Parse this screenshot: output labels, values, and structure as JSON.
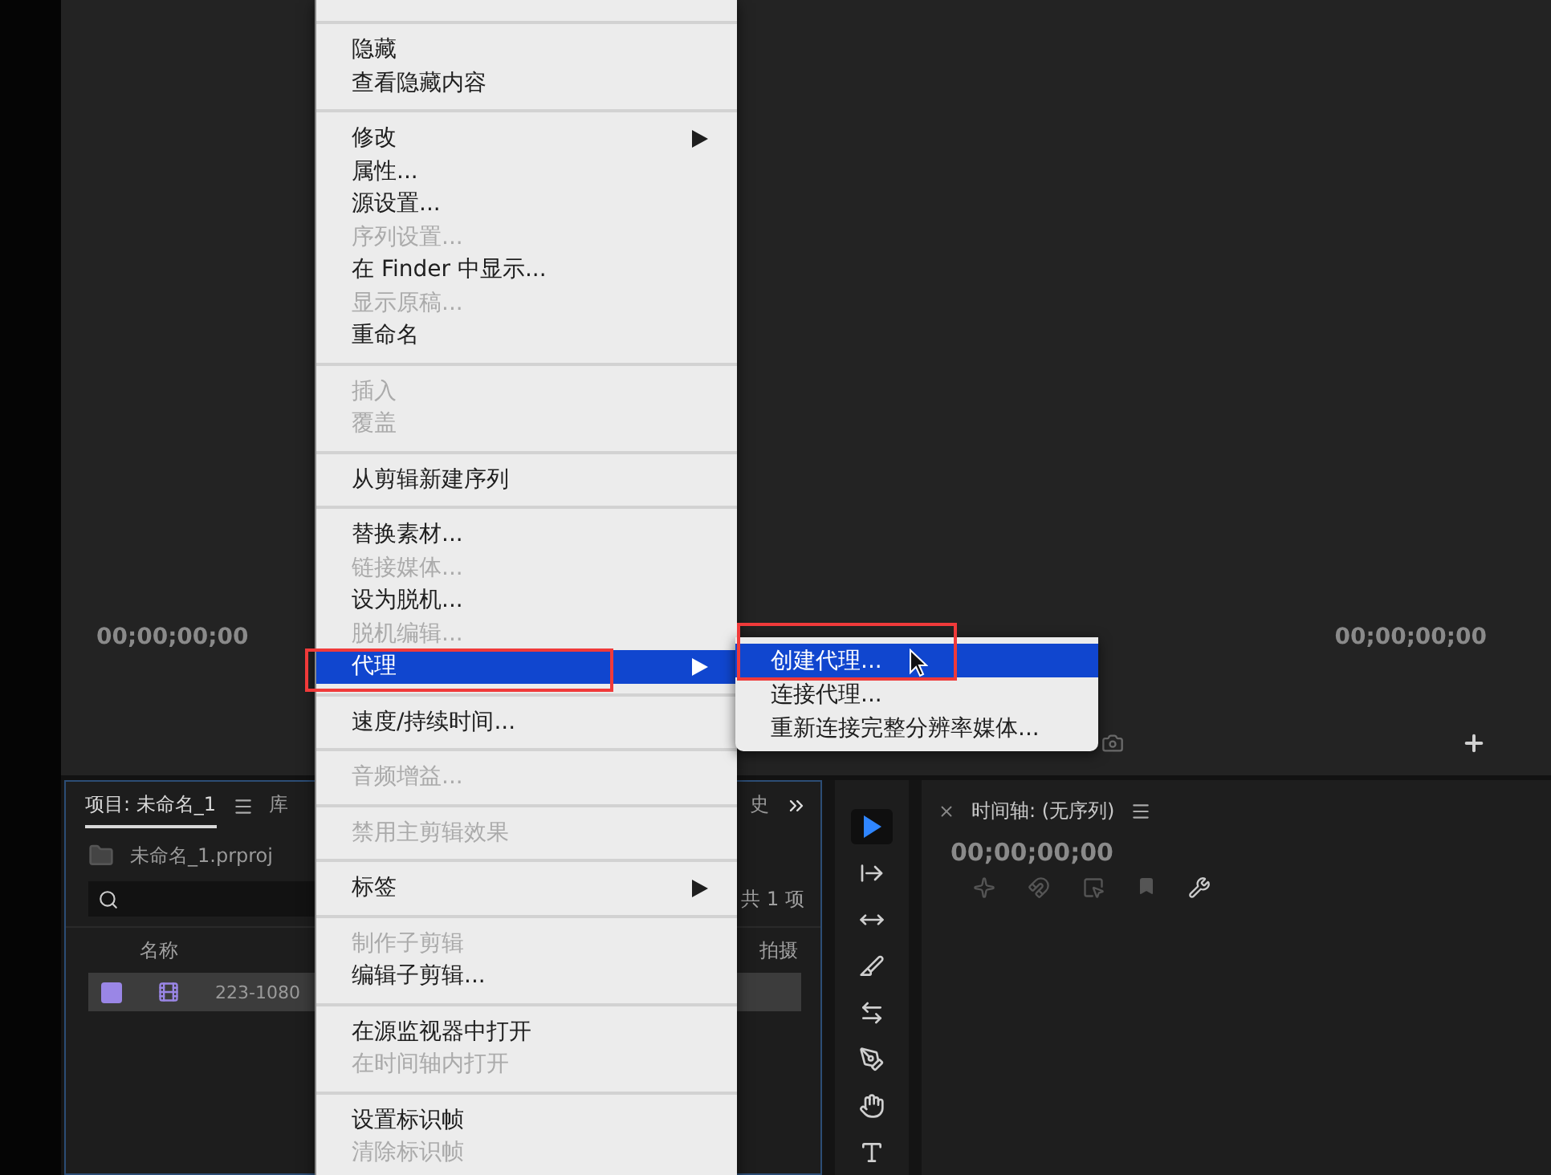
{
  "source_monitor": {
    "timecode_left": "00;00;00;00",
    "timecode_right": "00;00;00;00"
  },
  "project_panel": {
    "tabs": [
      {
        "label": "项目: 未命名_1",
        "selected": true
      },
      {
        "label": "库",
        "selected": false
      },
      {
        "label": "史",
        "selected": false
      }
    ],
    "file": "未命名_1.prproj",
    "item_count": "共 1 项",
    "columns": [
      "名称",
      "拍摄"
    ],
    "rows": [
      {
        "name": "223-1080",
        "selected": true,
        "color": "#9a86e6"
      }
    ]
  },
  "tools": [
    {
      "kind": "selection",
      "selected": true
    },
    {
      "kind": "track",
      "selected": false
    },
    {
      "kind": "ripple",
      "selected": false
    },
    {
      "kind": "razor",
      "selected": false
    },
    {
      "kind": "slip",
      "selected": false
    },
    {
      "kind": "pen",
      "selected": false
    },
    {
      "kind": "hand",
      "selected": false
    },
    {
      "kind": "type",
      "selected": false
    }
  ],
  "timeline_panel": {
    "title": "时间轴: (无序列)",
    "timecode": "00;00;00;00"
  },
  "context_menu": {
    "groups": [
      {
        "items": [
          {
            "label": "隐藏",
            "disabled": false,
            "submenu": false,
            "selected": false
          },
          {
            "label": "查看隐藏内容",
            "disabled": false,
            "submenu": false,
            "selected": false
          }
        ]
      },
      {
        "items": [
          {
            "label": "修改",
            "disabled": false,
            "submenu": true,
            "selected": false
          },
          {
            "label": "属性...",
            "disabled": false,
            "submenu": false,
            "selected": false
          },
          {
            "label": "源设置...",
            "disabled": false,
            "submenu": false,
            "selected": false
          },
          {
            "label": "序列设置...",
            "disabled": true,
            "submenu": false,
            "selected": false
          },
          {
            "label": "在 Finder 中显示...",
            "disabled": false,
            "submenu": false,
            "selected": false
          },
          {
            "label": "显示原稿...",
            "disabled": true,
            "submenu": false,
            "selected": false
          },
          {
            "label": "重命名",
            "disabled": false,
            "submenu": false,
            "selected": false
          }
        ]
      },
      {
        "items": [
          {
            "label": "插入",
            "disabled": true,
            "submenu": false,
            "selected": false
          },
          {
            "label": "覆盖",
            "disabled": true,
            "submenu": false,
            "selected": false
          }
        ]
      },
      {
        "items": [
          {
            "label": "从剪辑新建序列",
            "disabled": false,
            "submenu": false,
            "selected": false
          }
        ]
      },
      {
        "items": [
          {
            "label": "替换素材...",
            "disabled": false,
            "submenu": false,
            "selected": false
          },
          {
            "label": "链接媒体...",
            "disabled": true,
            "submenu": false,
            "selected": false
          },
          {
            "label": "设为脱机...",
            "disabled": false,
            "submenu": false,
            "selected": false
          },
          {
            "label": "脱机编辑...",
            "disabled": true,
            "submenu": false,
            "selected": false
          },
          {
            "label": "代理",
            "disabled": false,
            "submenu": true,
            "selected": true
          }
        ]
      },
      {
        "items": [
          {
            "label": "速度/持续时间...",
            "disabled": false,
            "submenu": false,
            "selected": false
          }
        ]
      },
      {
        "items": [
          {
            "label": "音频增益...",
            "disabled": true,
            "submenu": false,
            "selected": false
          }
        ]
      },
      {
        "items": [
          {
            "label": "禁用主剪辑效果",
            "disabled": true,
            "submenu": false,
            "selected": false
          }
        ]
      },
      {
        "items": [
          {
            "label": "标签",
            "disabled": false,
            "submenu": true,
            "selected": false
          }
        ]
      },
      {
        "items": [
          {
            "label": "制作子剪辑",
            "disabled": true,
            "submenu": false,
            "selected": false
          },
          {
            "label": "编辑子剪辑...",
            "disabled": false,
            "submenu": false,
            "selected": false
          }
        ]
      },
      {
        "items": [
          {
            "label": "在源监视器中打开",
            "disabled": false,
            "submenu": false,
            "selected": false
          },
          {
            "label": "在时间轴内打开",
            "disabled": true,
            "submenu": false,
            "selected": false
          }
        ]
      },
      {
        "items": [
          {
            "label": "设置标识帧",
            "disabled": false,
            "submenu": false,
            "selected": false
          },
          {
            "label": "清除标识帧",
            "disabled": true,
            "submenu": false,
            "selected": false
          }
        ]
      }
    ]
  },
  "submenu": {
    "items": [
      {
        "label": "创建代理...",
        "selected": true
      },
      {
        "label": "连接代理...",
        "selected": false
      },
      {
        "label": "重新连接完整分辨率媒体...",
        "selected": false
      }
    ]
  }
}
